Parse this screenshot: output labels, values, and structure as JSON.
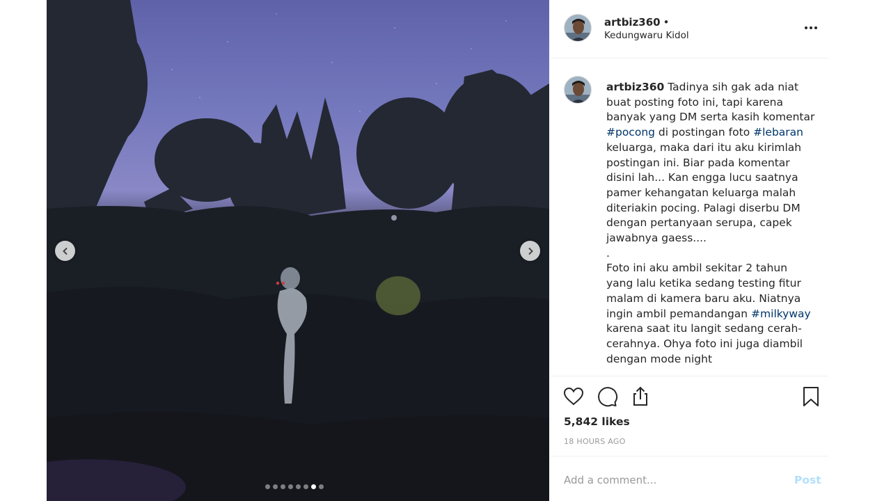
{
  "post": {
    "username": "artbiz360",
    "separator": "•",
    "location": "Kedungwaru Kidol",
    "caption_segments": [
      {
        "text": "Tadinya sih gak ada niat buat posting foto ini, tapi karena banyak yang DM serta kasih komentar ",
        "hashtag": false
      },
      {
        "text": "#pocong",
        "hashtag": true
      },
      {
        "text": " di postingan foto ",
        "hashtag": false
      },
      {
        "text": "#lebaran",
        "hashtag": true
      },
      {
        "text": " keluarga, maka dari itu aku kirimlah postingan ini. Biar pada komentar disini lah... Kan engga lucu saatnya pamer kehangatan keluarga malah diteriakin pocing. Palagi diserbu DM dengan pertanyaan serupa, capek jawabnya gaess....\n.\nFoto ini aku ambil sekitar 2 tahun yang lalu ketika sedang testing fitur malam di kamera baru aku. Niatnya ingin ambil pemandangan ",
        "hashtag": false
      },
      {
        "text": "#milkyway",
        "hashtag": true
      },
      {
        "text": " karena saat itu langit sedang cerah-cerahnya. Ohya foto ini juga diambil dengan mode night",
        "hashtag": false
      }
    ],
    "likes": "5,842 likes",
    "time": "18 HOURS AGO",
    "comment_placeholder": "Add a comment...",
    "post_label": "Post",
    "carousel": {
      "total": 8,
      "active": 6
    }
  },
  "icons": {
    "like": "heart-icon",
    "comment": "comment-bubble-icon",
    "share": "share-icon",
    "save": "bookmark-icon",
    "more": "more-options-icon",
    "prev": "chevron-left-icon",
    "next": "chevron-right-icon"
  },
  "colors": {
    "hashtag": "#003569",
    "post_button": "#b2dffc",
    "muted": "#999999"
  }
}
